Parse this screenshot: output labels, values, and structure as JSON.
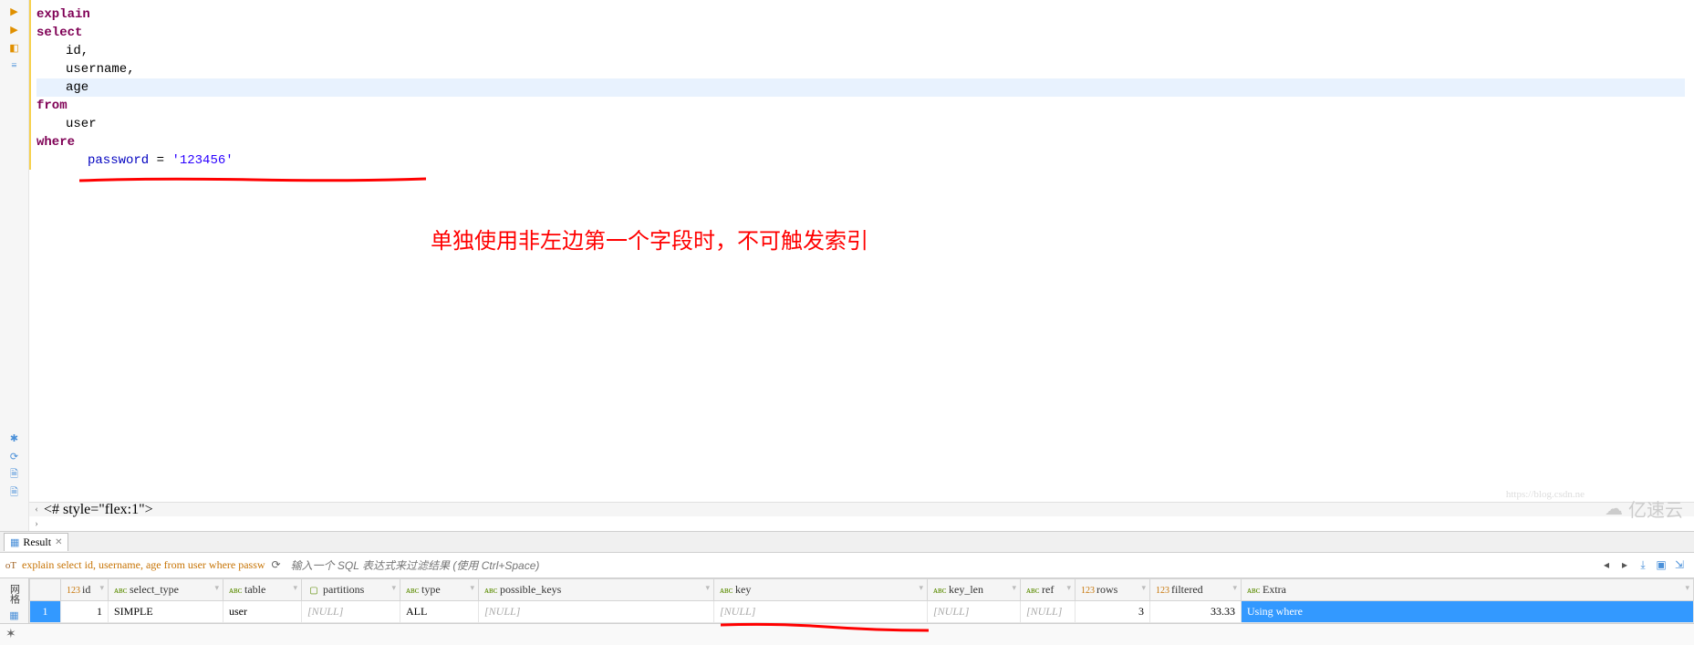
{
  "gutter_icons": [
    "▶",
    "▶",
    "◧",
    "≡"
  ],
  "editor_lower_icons": [
    "✱",
    "⟳",
    "🗎",
    "🗎"
  ],
  "sql": {
    "explain": "explain",
    "select": "select",
    "cols": [
      "id,",
      "username,",
      "age"
    ],
    "from": "from",
    "table": "user",
    "where": "where",
    "cond_col": "password",
    "cond_eq": "=",
    "cond_val": "'123456'"
  },
  "red_note": "单独使用非左边第一个字段时，不可触发索引",
  "result_tab": "Result",
  "query_echo": "explain select id, username, age from user where passw",
  "filter_placeholder": "输入一个 SQL 表达式来过滤结果 (使用 Ctrl+Space)",
  "grid_gutter": "网格",
  "headers": {
    "id": "id",
    "select_type": "select_type",
    "table": "table",
    "partitions": "partitions",
    "type": "type",
    "possible_keys": "possible_keys",
    "key": "key",
    "key_len": "key_len",
    "ref": "ref",
    "rows": "rows",
    "filtered": "filtered",
    "extra": "Extra"
  },
  "row": {
    "num": "1",
    "id": "1",
    "select_type": "SIMPLE",
    "table": "user",
    "partitions": "[NULL]",
    "type": "ALL",
    "possible_keys": "[NULL]",
    "key": "[NULL]",
    "key_len": "[NULL]",
    "ref": "[NULL]",
    "rows": "3",
    "filtered": "33.33",
    "extra": "Using where"
  },
  "watermark": "亿速云",
  "watermark_sub": "https://blog.csdn.ne"
}
